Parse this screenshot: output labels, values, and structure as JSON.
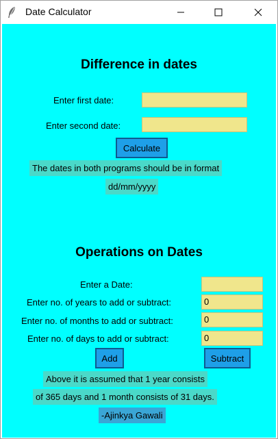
{
  "window": {
    "title": "Date Calculator"
  },
  "difference": {
    "heading": "Difference in dates",
    "first_label": "Enter first date:",
    "first_value": "",
    "second_label": "Enter second date:",
    "second_value": "",
    "calculate_label": "Calculate",
    "note_line1": "The dates in both programs should be in format",
    "note_line2": "dd/mm/yyyy"
  },
  "operations": {
    "heading": "Operations on Dates",
    "date_label": "Enter a Date:",
    "date_value": "",
    "years_label": "Enter no. of years to add or subtract:",
    "years_value": "0",
    "months_label": "Enter no. of months to add or subtract:",
    "months_value": "0",
    "days_label": "Enter no. of days to add or subtract:",
    "days_value": "0",
    "add_label": "Add",
    "subtract_label": "Subtract",
    "note_line1": "Above it is assumed that 1 year consists",
    "note_line2": "of 365 days and 1 month consists of 31 days.",
    "author": "-Ajinkya Gawali"
  },
  "icons": [
    "feather-icon",
    "minimize-icon",
    "maximize-icon",
    "close-icon"
  ]
}
